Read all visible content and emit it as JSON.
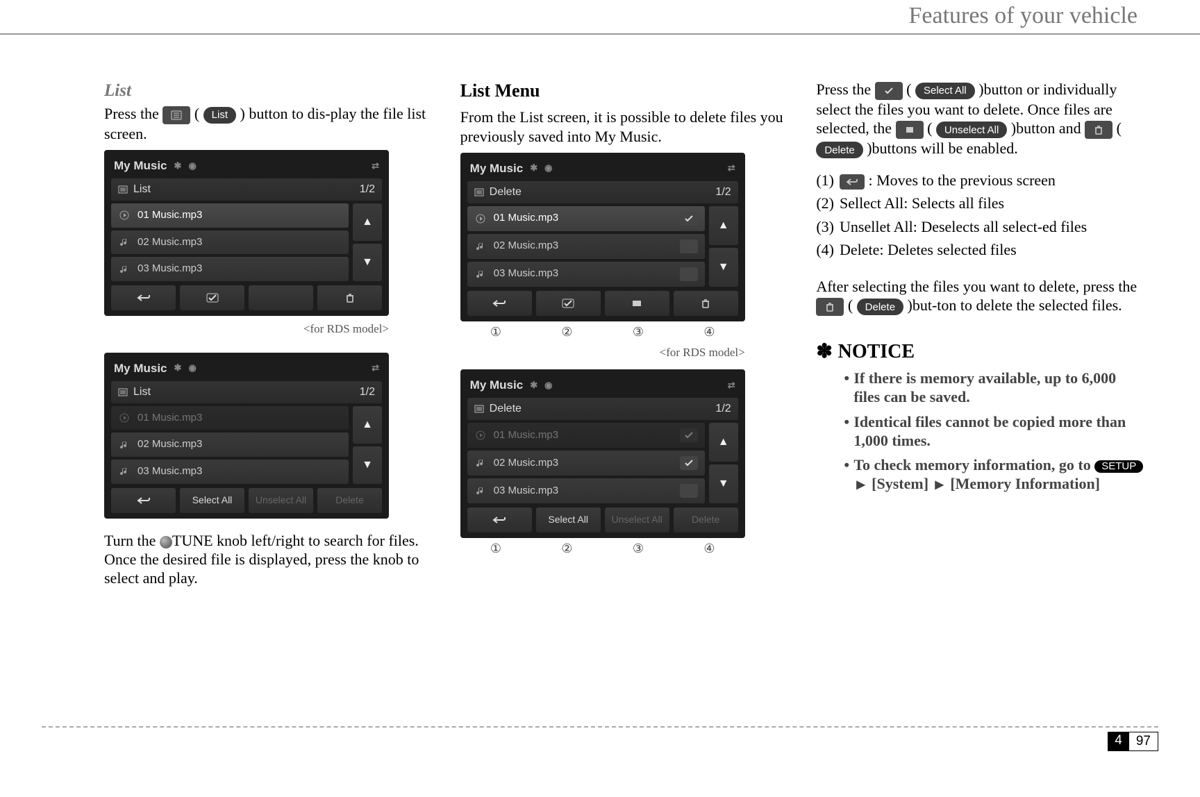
{
  "header": {
    "title": "Features of your vehicle"
  },
  "footer": {
    "section": "4",
    "page": "97"
  },
  "col1": {
    "heading": "List",
    "p1_a": "Press the ",
    "list_pill": "List",
    "p1_b": "button to dis-play the file list screen.",
    "caption": "<for RDS model>",
    "p2": "Turn the  TUNE knob left/right to search for files. Once the desired file is displayed, press the knob to select and play."
  },
  "col2": {
    "heading": "List Menu",
    "p1": "From the List screen, it is possible to delete files you previously saved into My Music.",
    "caption": "<for RDS model>"
  },
  "col3": {
    "p1_a": "Press the ",
    "select_all": "Select All",
    "p1_b": "button or individually select the files you want to delete. Once files are selected, the",
    "unselect_all": "Unselect All",
    "p1_c": "button and",
    "delete": "Delete",
    "p1_d": "buttons will be enabled.",
    "items": [
      {
        "n": "(1)",
        "t": " : Moves to the previous screen",
        "icon": true
      },
      {
        "n": "(2)",
        "t": "Sellect All: Selects all files"
      },
      {
        "n": "(3)",
        "t": "Unsellet All: Deselects all select-ed files"
      },
      {
        "n": "(4)",
        "t": "Delete: Deletes selected files"
      }
    ],
    "p2_a": "After selecting the files you want to delete, press the ",
    "p2_b": "but-ton to delete the selected files.",
    "notice_label": "NOTICE",
    "notice": [
      "If there is memory available, up to 6,000 files can be saved.",
      "Identical files cannot be copied more than 1,000 times.",
      "To check memory information, go to  ▸ [System] ▸ [Memory Information]"
    ],
    "setup": "SETUP",
    "n3_a": "To check memory information, go to ",
    "n3_b": " [System] ",
    "n3_c": " [Memory Information]"
  },
  "screens": {
    "listA": {
      "title": "My Music",
      "list_label": "List",
      "page": "1/2",
      "rows": [
        {
          "icon": "play",
          "label": "01 Music.mp3",
          "sel": true
        },
        {
          "icon": "note",
          "label": "02 Music.mp3"
        },
        {
          "icon": "note",
          "label": "03 Music.mp3"
        }
      ],
      "bottom": [
        "back",
        "check",
        "blank",
        "trash"
      ]
    },
    "listB": {
      "title": "My Music",
      "list_label": "List",
      "page": "1/2",
      "rows": [
        {
          "icon": "play",
          "label": "01 Music.mp3",
          "dim": true
        },
        {
          "icon": "note",
          "label": "02 Music.mp3"
        },
        {
          "icon": "note",
          "label": "03 Music.mp3"
        }
      ],
      "bottom_labels": {
        "b1": "Select All",
        "b2": "Unselect All",
        "b3": "Delete"
      }
    },
    "delA": {
      "title": "My Music",
      "list_label": "Delete",
      "page": "1/2",
      "rows": [
        {
          "icon": "play",
          "label": "01 Music.mp3",
          "sel": true,
          "chk": true
        },
        {
          "icon": "note",
          "label": "02 Music.mp3",
          "chk": false
        },
        {
          "icon": "note",
          "label": "03 Music.mp3",
          "chk": false
        }
      ],
      "bottom": [
        "back",
        "check",
        "rect",
        "trash"
      ]
    },
    "delB": {
      "title": "My Music",
      "list_label": "Delete",
      "page": "1/2",
      "rows": [
        {
          "icon": "play",
          "label": "01 Music.mp3",
          "dim": true,
          "chk": true
        },
        {
          "icon": "note",
          "label": "02 Music.mp3",
          "chk": true
        },
        {
          "icon": "note",
          "label": "03 Music.mp3",
          "chk": false
        }
      ],
      "bottom_labels": {
        "b1": "Select All",
        "b2": "Unselect All",
        "b3": "Delete"
      }
    },
    "callouts": [
      "①",
      "②",
      "③",
      "④"
    ]
  }
}
